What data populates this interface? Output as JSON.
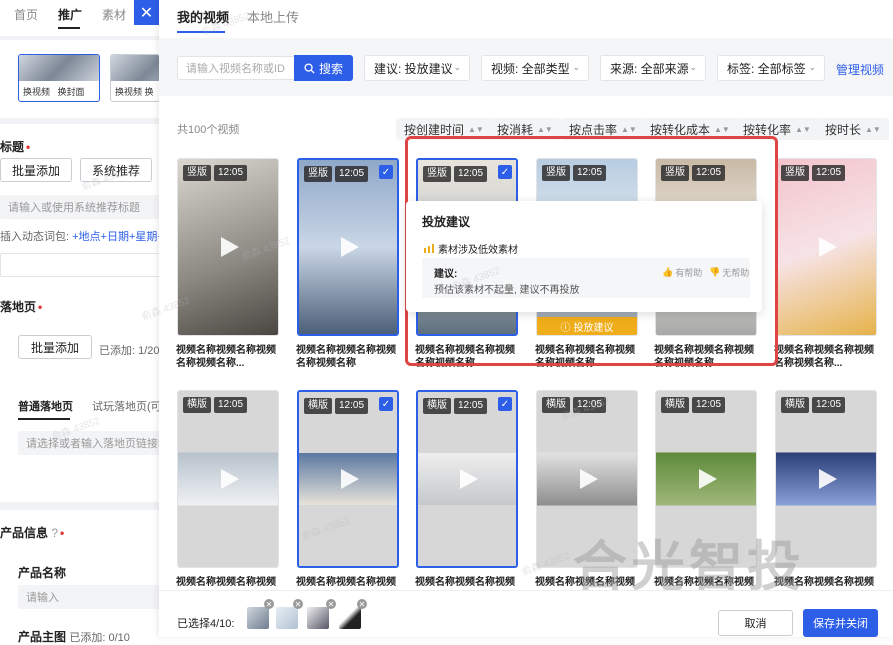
{
  "left_panel": {
    "tabs": [
      "首页",
      "推广",
      "素材"
    ],
    "thumb_labels": [
      "换视频",
      "换封面"
    ],
    "thumb2_label": "换视频 换",
    "title_label": "标题",
    "btn_batch_add": "批量添加",
    "btn_sys_recommend": "系统推荐",
    "title_placeholder": "请输入或使用系统推荐标题",
    "dyn_word_prefix": "插入动态词包:",
    "dyn_words": "+地点+日期+星期+年",
    "landing_label": "落地页",
    "landing_batch_add": "批量添加",
    "landing_added": "已添加: 1/20",
    "tab_normal_landing": "普通落地页",
    "tab_trial_landing": "试玩落地页(可",
    "landing_placeholder": "请选择或者输入落地页链接地",
    "product_info": "产品信息",
    "product_name": "产品名称",
    "product_placeholder": "请输入",
    "product_main_image": "产品主图",
    "product_main_added": "已添加: 0/10"
  },
  "drawer": {
    "tabs": [
      "我的视频",
      "本地上传"
    ],
    "search_placeholder": "请输入视频名称或ID",
    "search_btn": "搜索",
    "filters": [
      "建议: 投放建议",
      "视频: 全部类型",
      "来源: 全部来源",
      "标签: 全部标签"
    ],
    "manage_link": "管理视频",
    "total": "共100个视频",
    "sorts": [
      "按创建时间",
      "按消耗",
      "按点击率",
      "按转化成本",
      "按转化率",
      "按时长"
    ],
    "videos": [
      {
        "orient": "竖版",
        "dur": "12:05",
        "title": "视频名称视频名称视频名称视频名称...",
        "selected": false
      },
      {
        "orient": "竖版",
        "dur": "12:05",
        "title": "视频名称视频名称视频名称视频名称",
        "selected": true
      },
      {
        "orient": "竖版",
        "dur": "12:05",
        "title": "视频名称视频名称视频名称视频名称",
        "selected": true
      },
      {
        "orient": "竖版",
        "dur": "12:05",
        "title": "视频名称视频名称视频名称视频名称",
        "selected": false
      },
      {
        "orient": "竖版",
        "dur": "12:05",
        "title": "视频名称视频名称视频名称视频名称",
        "selected": false
      },
      {
        "orient": "竖版",
        "dur": "12:05",
        "title": "视频名称视频名称视频名称视频名称...",
        "selected": false
      },
      {
        "orient": "横版",
        "dur": "12:05",
        "title": "视频名称视频名称视频名称",
        "selected": false
      },
      {
        "orient": "横版",
        "dur": "12:05",
        "title": "视频名称视频名称视频名称",
        "selected": true
      },
      {
        "orient": "横版",
        "dur": "12:05",
        "title": "视频名称视频名称视频名称",
        "selected": true
      },
      {
        "orient": "横版",
        "dur": "12:05",
        "title": "视频名称视频名称视频名称",
        "selected": false
      },
      {
        "orient": "横版",
        "dur": "12:05",
        "title": "视频名称视频名称视频名称",
        "selected": false
      },
      {
        "orient": "横版",
        "dur": "12:05",
        "title": "视频名称视频名称视频名称",
        "selected": false
      }
    ],
    "tip_button": "投放建议",
    "popover": {
      "title": "投放建议",
      "item": "素材涉及低效素材",
      "key": "建议:",
      "value": "预估该素材不起量, 建议不再投放",
      "helpful": "有帮助",
      "not_helpful": "无帮助"
    },
    "selected_count": "已选择4/10:",
    "cancel": "取消",
    "save": "保存并关闭"
  },
  "watermark": "合光智投",
  "watermark_small": "俞森 43852",
  "colors": {
    "accent": "#2d5ee8",
    "warning": "#f0ad1a",
    "highlight_box": "#e04545"
  }
}
